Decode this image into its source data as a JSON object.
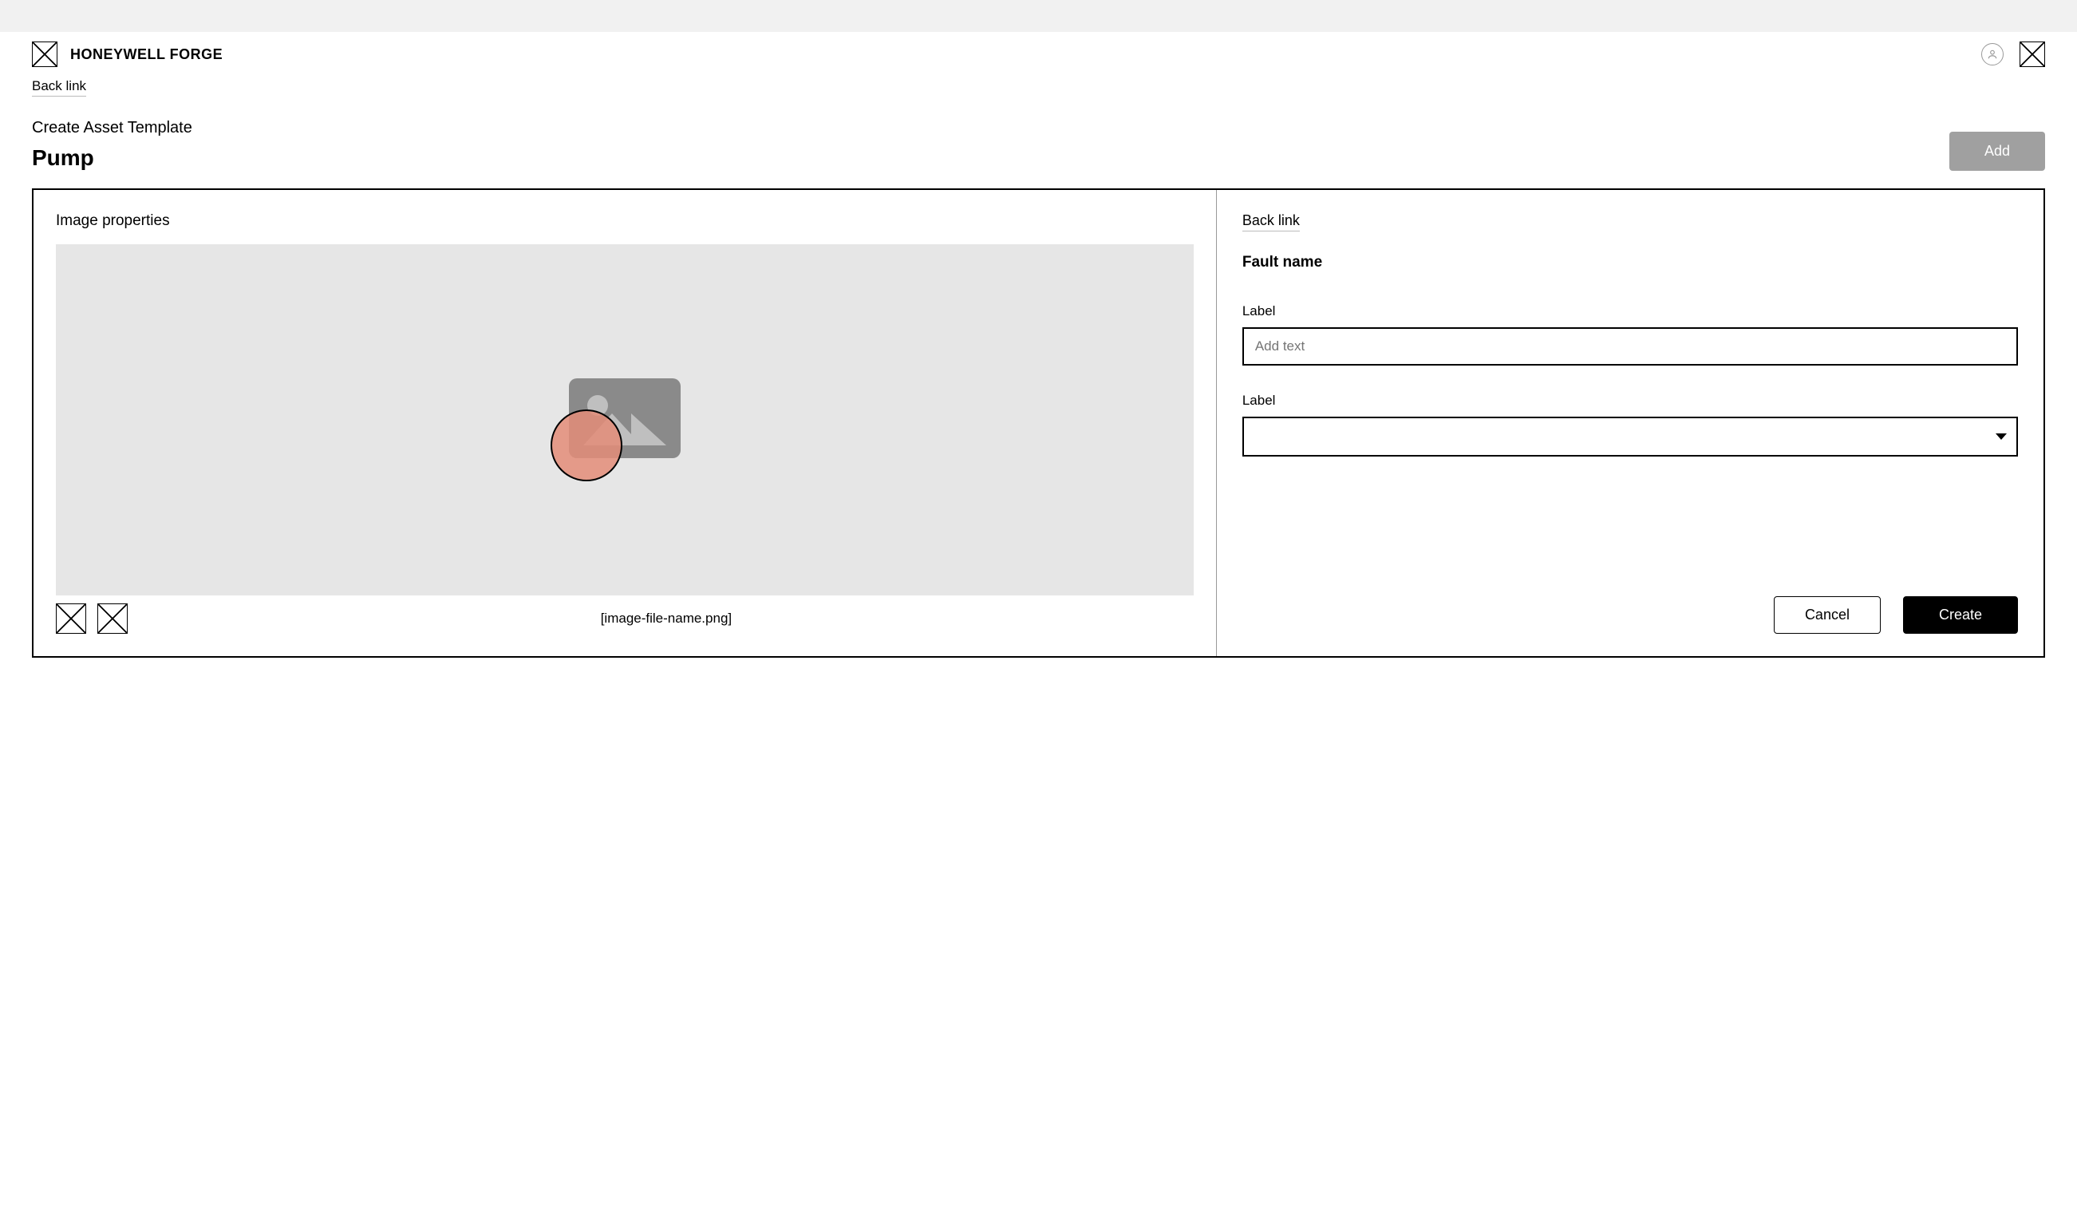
{
  "header": {
    "brand": "HONEYWELL FORGE",
    "back_link": "Back link"
  },
  "subheader": {
    "label": "Create Asset Template",
    "title": "Pump",
    "add_button": "Add"
  },
  "left": {
    "section_title": "Image properties",
    "filename": "[image-file-name.png]",
    "marker_color": "#e38c78"
  },
  "right": {
    "back_link": "Back link",
    "fault_name_label": "Fault name",
    "field1_label": "Label",
    "field1_placeholder": "Add text",
    "field2_label": "Label",
    "dropdown_value": "",
    "cancel_button": "Cancel",
    "create_button": "Create"
  }
}
